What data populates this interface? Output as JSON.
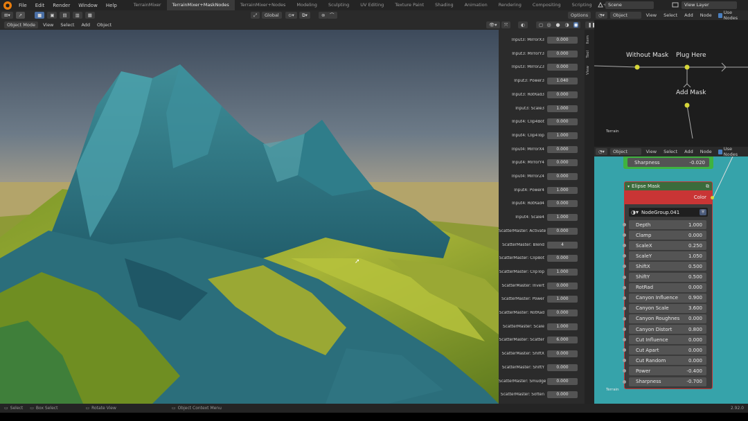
{
  "menubar": {
    "menus": [
      "File",
      "Edit",
      "Render",
      "Window",
      "Help"
    ],
    "workspaces": [
      "TerrainMixer",
      "TerrainMixer+MaskNodes",
      "TerrainMixer+Nodes",
      "Modeling",
      "Sculpting",
      "UV Editing",
      "Texture Paint",
      "Shading",
      "Animation",
      "Rendering",
      "Compositing",
      "Scripting"
    ],
    "active_workspace": "TerrainMixer+MaskNodes",
    "plus": "+",
    "scene": "Scene",
    "view_layer": "View Layer"
  },
  "viewport_header": {
    "transform_orientation": "Global",
    "options": "Options",
    "mode": "Object Mode",
    "menus": [
      "View",
      "Select",
      "Add",
      "Object"
    ]
  },
  "npanel": {
    "tabs": [
      "Item",
      "Tool",
      "View"
    ],
    "rows": [
      {
        "label": "Input3: MirrorX3",
        "value": "0.000"
      },
      {
        "label": "Input3: MirrorY3",
        "value": "0.000"
      },
      {
        "label": "Input3: MirrorZ3",
        "value": "0.000"
      },
      {
        "label": "Input3: Power3",
        "value": "1.040"
      },
      {
        "label": "Input3: RotRad3",
        "value": "0.000"
      },
      {
        "label": "Input3: Scale3",
        "value": "1.000"
      },
      {
        "label": "Input4: Clip4Bot",
        "value": "0.000"
      },
      {
        "label": "Input4: Clip4Top",
        "value": "1.000"
      },
      {
        "label": "Input4: MirrorX4",
        "value": "0.000"
      },
      {
        "label": "Input4: MirrorY4",
        "value": "0.000"
      },
      {
        "label": "Input4: MirrorZ4",
        "value": "0.000"
      },
      {
        "label": "Input4: Power4",
        "value": "1.000"
      },
      {
        "label": "Input4: RotRad4",
        "value": "0.000"
      },
      {
        "label": "Input4: Scale4",
        "value": "1.000"
      },
      {
        "label": "ScatterMaster: Activate",
        "value": "0.000"
      },
      {
        "label": "ScatterMaster: Blend",
        "value": "4"
      },
      {
        "label": "ScatterMaster: ClipBot",
        "value": "0.000"
      },
      {
        "label": "ScatterMaster: ClipTop",
        "value": "1.000"
      },
      {
        "label": "ScatterMaster: Invert",
        "value": "0.000"
      },
      {
        "label": "ScatterMaster: Power",
        "value": "1.000"
      },
      {
        "label": "ScatterMaster: RotRad",
        "value": "0.000"
      },
      {
        "label": "ScatterMaster: Scale",
        "value": "1.000"
      },
      {
        "label": "ScatterMaster: Scatter",
        "value": "6.000"
      },
      {
        "label": "ScatterMaster: ShiftX",
        "value": "0.000"
      },
      {
        "label": "ScatterMaster: ShiftY",
        "value": "0.000"
      },
      {
        "label": "ScatterMaster: Smudge",
        "value": "0.000"
      },
      {
        "label": "ScatterMaster: Soften",
        "value": "0.000"
      }
    ]
  },
  "node_editor_top": {
    "header": {
      "object": "Object",
      "menus": [
        "View",
        "Select",
        "Add",
        "Node"
      ],
      "use_nodes": "Use Nodes"
    },
    "labels": {
      "without_mask": "Without Mask",
      "plug_here": "Plug Here",
      "add_mask": "Add Mask",
      "terrain": "Terrain"
    }
  },
  "node_editor_bottom": {
    "header": {
      "object": "Object",
      "menus": [
        "View",
        "Select",
        "Add",
        "Node"
      ],
      "use_nodes": "Use Nodes"
    },
    "sharpness_top": {
      "label": "Sharpness",
      "value": "-0.020"
    },
    "terrain": "Terrain",
    "node": {
      "title": "Elipse Mask",
      "output": "Color",
      "group": "NodeGroup.041",
      "inputs": [
        {
          "label": "Depth",
          "value": "1.000"
        },
        {
          "label": "Clamp",
          "value": "0.000"
        },
        {
          "label": "ScaleX",
          "value": "0.250"
        },
        {
          "label": "ScaleY",
          "value": "1.050"
        },
        {
          "label": "ShiftX",
          "value": "0.500"
        },
        {
          "label": "ShiftY",
          "value": "0.500"
        },
        {
          "label": "RotRad",
          "value": "0.000"
        },
        {
          "label": "Canyon Influence",
          "value": "0.900"
        },
        {
          "label": "Canyon Scale",
          "value": "3.600"
        },
        {
          "label": "Canyon Roughnes",
          "value": "0.000"
        },
        {
          "label": "Canyon Distort",
          "value": "0.800"
        },
        {
          "label": "Cut Influence",
          "value": "0.000"
        },
        {
          "label": "Cut Apart",
          "value": "0.000"
        },
        {
          "label": "Cut Random",
          "value": "0.000"
        },
        {
          "label": "Power",
          "value": "-0.400"
        },
        {
          "label": "Sharpness",
          "value": "-0.700"
        }
      ]
    }
  },
  "statusbar": {
    "items": [
      "Select",
      "Box Select",
      "Rotate View",
      "Object Context Menu"
    ],
    "version": "2.92.0"
  },
  "colors": {
    "accent_orange": "#e87d0d",
    "node_header_red": "#c93535",
    "node_bg_teal": "#36a3aa",
    "green_node": "#3fb23f",
    "socket_yellow": "#d6d63a"
  }
}
